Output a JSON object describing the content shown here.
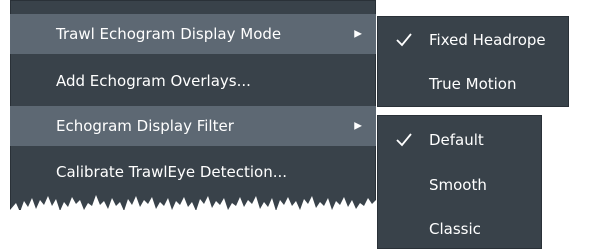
{
  "main_menu": {
    "items": [
      {
        "label": "Trawl Echogram Display Mode",
        "has_submenu": true,
        "highlighted": true
      },
      {
        "label": "Add Echogram Overlays...",
        "has_submenu": false,
        "highlighted": false
      },
      {
        "label": "Echogram Display Filter",
        "has_submenu": true,
        "highlighted": true
      },
      {
        "label": "Calibrate TrawlEye Detection...",
        "has_submenu": false,
        "highlighted": false
      }
    ],
    "submenu_arrow": "▶"
  },
  "display_mode_submenu": {
    "items": [
      {
        "label": "Fixed Headrope",
        "checked": true
      },
      {
        "label": "True Motion",
        "checked": false
      }
    ]
  },
  "display_filter_submenu": {
    "items": [
      {
        "label": "Default",
        "checked": true
      },
      {
        "label": "Smooth",
        "checked": false
      },
      {
        "label": "Classic",
        "checked": false
      }
    ]
  },
  "icons": {
    "checkmark": "checkmark-icon",
    "submenu_arrow": "chevron-right-icon"
  },
  "colors": {
    "menu_bg": "#39424a",
    "highlight_bg": "#5d6873",
    "text": "#ffffff"
  }
}
